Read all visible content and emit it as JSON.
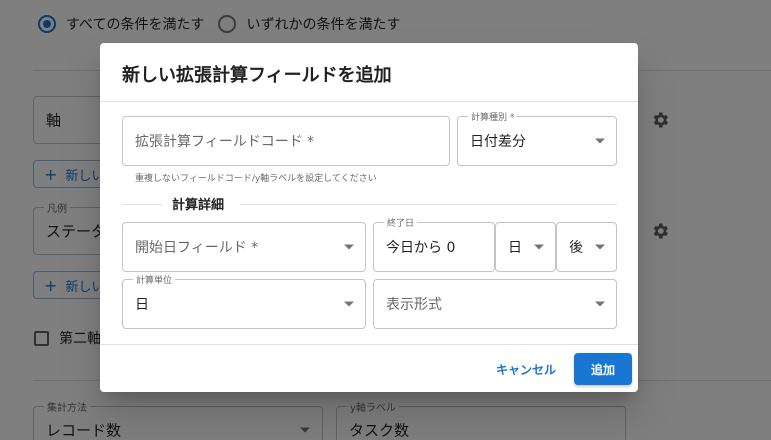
{
  "background": {
    "match_options": {
      "all_label": "すべての条件を満たす",
      "any_label": "いずれかの条件を満たす"
    },
    "axis_field": {
      "value": "軸"
    },
    "add_button_1": {
      "label": "新しい"
    },
    "legend_field": {
      "label": "凡例",
      "value": "ステータス"
    },
    "add_button_2": {
      "label": "新しい"
    },
    "second_axis": {
      "label": "第二軸"
    },
    "aggregate_field": {
      "label": "集計方法",
      "value": "レコード数"
    },
    "y_label_field": {
      "label": "y軸ラベル",
      "value": "タスク数"
    }
  },
  "dialog": {
    "title": "新しい拡張計算フィールドを追加",
    "code_field": {
      "placeholder": "拡張計算フィールドコード *"
    },
    "calc_type": {
      "label": "計算種別 *",
      "value": "日付差分"
    },
    "helper_text": "重複しないフィールドコード/y軸ラベルを設定してください",
    "section_title": "計算詳細",
    "start_date": {
      "placeholder": "開始日フィールド *"
    },
    "end_date": {
      "label": "終了日",
      "value": "今日から 0"
    },
    "unit_select": {
      "value": "日"
    },
    "direction_select": {
      "value": "後"
    },
    "calc_unit": {
      "label": "計算単位",
      "value": "日"
    },
    "display_format": {
      "placeholder": "表示形式"
    },
    "cancel_label": "キャンセル",
    "add_label": "追加"
  },
  "colors": {
    "primary": "#1976d2",
    "overlay": "rgba(0,0,0,0.5)"
  }
}
